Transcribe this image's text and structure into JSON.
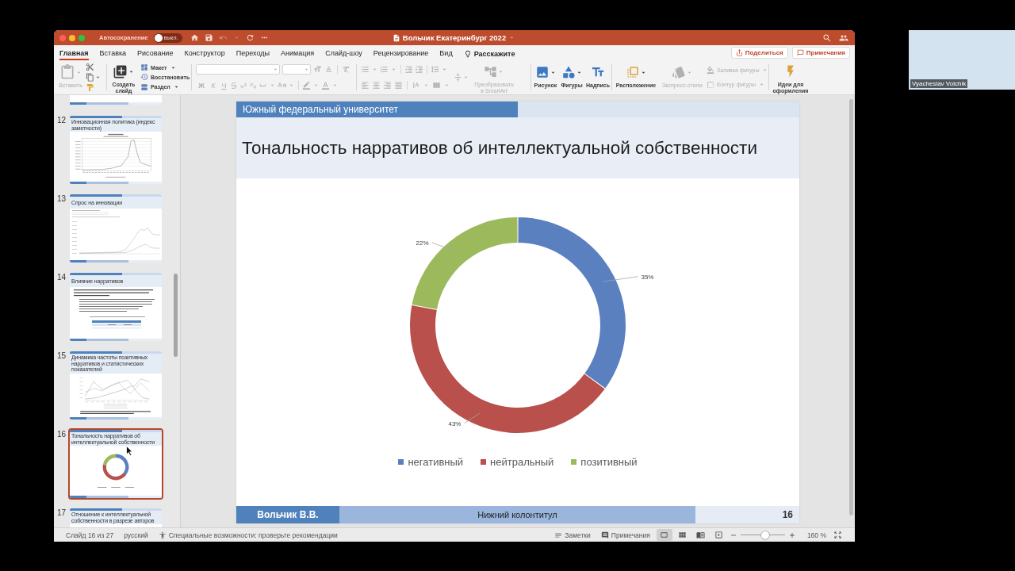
{
  "title_bar": {
    "autosave": {
      "label": "Автосохранение",
      "on": false,
      "state_label": "выкл."
    },
    "document_title": "Вольчик Екатеринбург 2022"
  },
  "tabs": [
    {
      "label": "Главная",
      "selected": true
    },
    {
      "label": "Вставка",
      "selected": false
    },
    {
      "label": "Рисование",
      "selected": false
    },
    {
      "label": "Конструктор",
      "selected": false
    },
    {
      "label": "Переходы",
      "selected": false
    },
    {
      "label": "Анимация",
      "selected": false
    },
    {
      "label": "Слайд-шоу",
      "selected": false
    },
    {
      "label": "Рецензирование",
      "selected": false
    },
    {
      "label": "Вид",
      "selected": false
    }
  ],
  "tell_me": "Расскажите",
  "share_button": "Поделиться",
  "comments_button": "Примечания",
  "ribbon": {
    "paste": {
      "label": "Вставить",
      "disabled": true
    },
    "new_slide": {
      "label": "Создать слайд",
      "disabled": false
    },
    "layout": {
      "label": "Макет",
      "disabled": false
    },
    "reset": {
      "label": "Восстановить",
      "disabled": false
    },
    "section": {
      "label": "Раздел",
      "disabled": false
    },
    "font_styles": [
      {
        "label": "Ж",
        "disabled": true
      },
      {
        "label": "К",
        "disabled": true
      },
      {
        "label": "Ч",
        "disabled": true
      }
    ],
    "convert_smartart": {
      "label": "Преобразовать в SmartArt",
      "disabled": true
    },
    "picture": {
      "label": "Рисунок",
      "disabled": false
    },
    "shapes": {
      "label": "Фигуры",
      "disabled": false
    },
    "text_box": {
      "label": "Надпись",
      "disabled": false
    },
    "arrange": {
      "label": "Расположение",
      "disabled": false
    },
    "quick_styles": {
      "label": "Экспресс-стили",
      "disabled": true
    },
    "shape_fill": {
      "label": "Заливка фигуры",
      "disabled": true
    },
    "shape_outline": {
      "label": "Контур фигуры",
      "disabled": true
    },
    "design_ideas": {
      "label": "Идеи для оформления",
      "disabled": false
    }
  },
  "thumbnails": [
    {
      "number": "12",
      "title": "Инновационная политика (индекс заметности)",
      "kind": "peak_chart",
      "selected": false
    },
    {
      "number": "13",
      "title": "Спрос на инновации",
      "kind": "line_chart",
      "selected": false
    },
    {
      "number": "14",
      "title": "Влияние нарративов",
      "kind": "text_table",
      "selected": false
    },
    {
      "number": "15",
      "title": "Динамика частоты позитивных нарративов и статистических показателей",
      "kind": "line_chart_text",
      "selected": false
    },
    {
      "number": "16",
      "title": "Тональность нарративов об интеллектуальной собственности",
      "kind": "donut",
      "selected": true
    },
    {
      "number": "17",
      "title": "Отношение к интеллектуальной собственности в разрезе авторов",
      "kind": "title_only",
      "selected": false
    }
  ],
  "slide": {
    "header": "Южный федеральный университет",
    "title": "Тональность нарративов об интеллектуальной собственности",
    "chart_data": {
      "type": "donut",
      "categories": [
        "негативный",
        "нейтральный",
        "позитивный"
      ],
      "values": [
        35,
        43,
        22
      ],
      "value_labels": [
        "35%",
        "43%",
        "22%"
      ],
      "colors": [
        "#5b80c0",
        "#b9504b",
        "#9cba5c"
      ],
      "legend": "bottom"
    },
    "footer": {
      "author": "Вольчик В.В.",
      "text": "Нижний колонтитул",
      "slide_number": "16"
    }
  },
  "status_bar": {
    "slide_position": "Слайд 16 из 27",
    "language": "русский",
    "accessibility": "Специальные возможности: проверьте рекомендации",
    "notes": "Заметки",
    "comments": "Примечания",
    "views": [
      {
        "selected": true
      },
      {
        "selected": false
      },
      {
        "selected": false
      },
      {
        "selected": false
      }
    ],
    "zoom": {
      "level": 0.55,
      "reading": "160 %"
    }
  },
  "video_tile": {
    "name": "Vyacheslav Volchik"
  }
}
